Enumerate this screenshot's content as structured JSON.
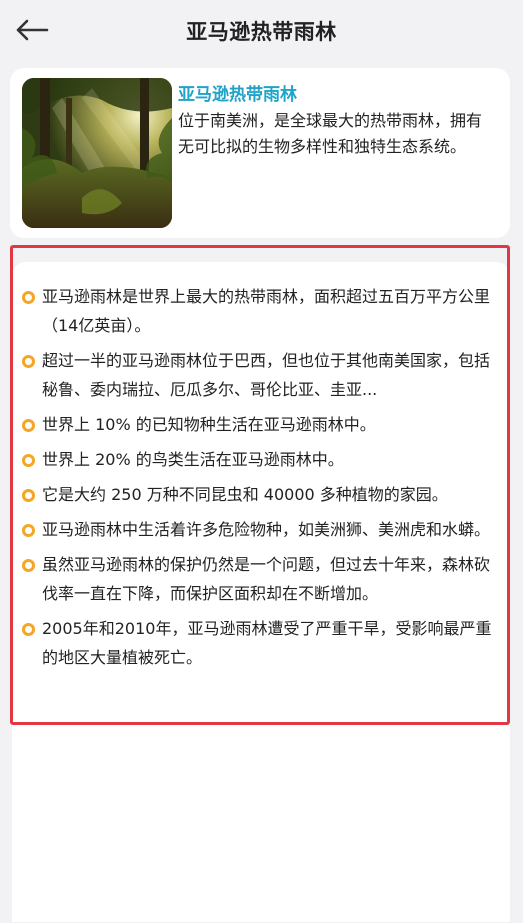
{
  "header": {
    "title": "亚马逊热带雨林",
    "back_icon": "arrow-left-icon"
  },
  "intro": {
    "title": "亚马逊热带雨林",
    "description": "位于南美洲，是全球最大的热带雨林，拥有无可比拟的生物多样性和独特生态系统。",
    "thumbnail_icon": "rainforest-image"
  },
  "facts": [
    "亚马逊雨林是世界上最大的热带雨林，面积超过五百万平方公里（14亿英亩）。",
    "超过一半的亚马逊雨林位于巴西，但也位于其他南美国家，包括秘鲁、委内瑞拉、厄瓜多尔、哥伦比亚、圭亚...",
    "世界上 10% 的已知物种生活在亚马逊雨林中。",
    "世界上 20% 的鸟类生活在亚马逊雨林中。",
    "它是大约 250 万种不同昆虫和 40000 多种植物的家园。",
    "亚马逊雨林中生活着许多危险物种，如美洲狮、美洲虎和水蟒。",
    "虽然亚马逊雨林的保护仍然是一个问题，但过去十年来，森林砍伐率一直在下降，而保护区面积却在不断增加。",
    "2005年和2010年，亚马逊雨林遭受了严重干旱，受影响最严重的地区大量植被死亡。"
  ],
  "colors": {
    "accent_title": "#1fa3c9",
    "bullet": "#f5a623",
    "highlight_border": "#e03844",
    "background": "#f2f2f4"
  }
}
